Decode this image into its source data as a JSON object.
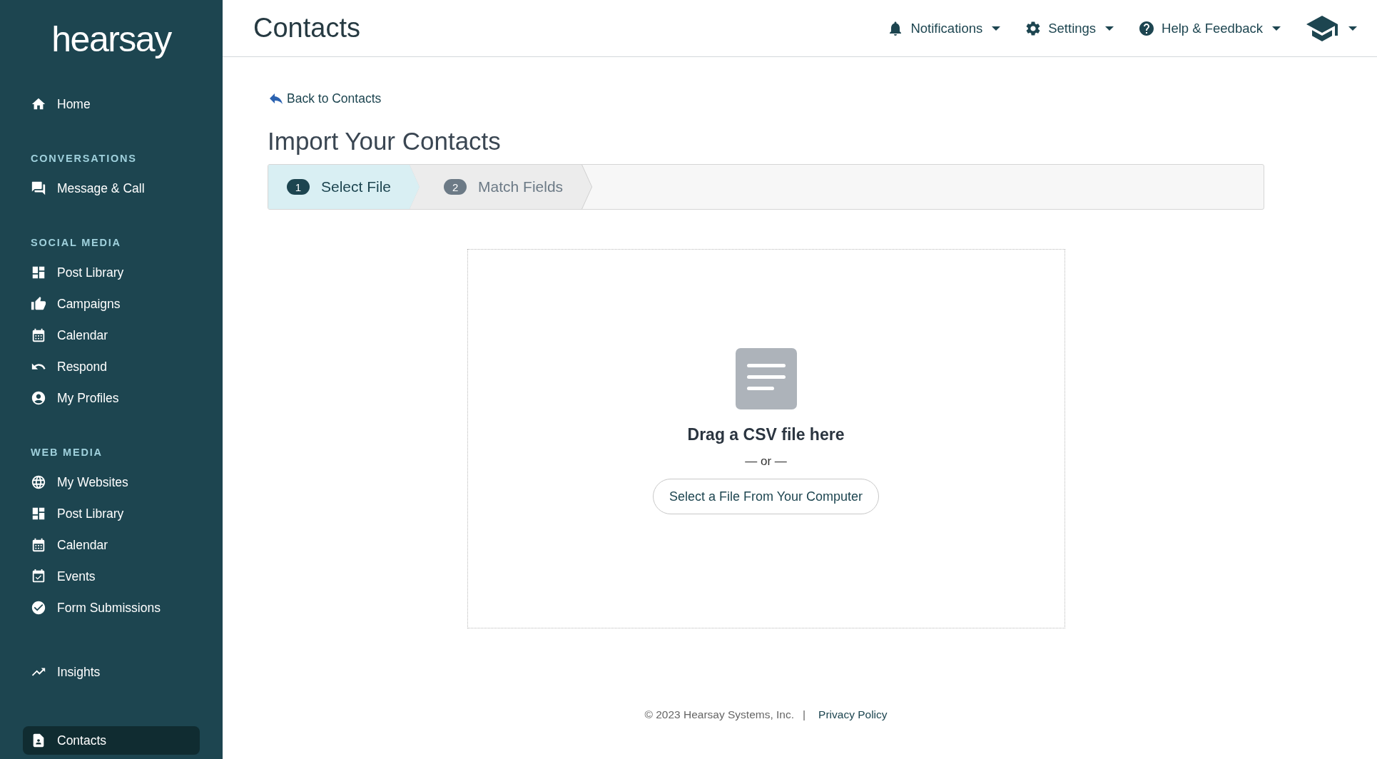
{
  "sidebar": {
    "logo": "hearsay",
    "sections": [
      {
        "items": [
          {
            "label": "Home",
            "selected": false
          }
        ]
      },
      {
        "heading": "CONVERSATIONS",
        "items": [
          {
            "label": "Message & Call",
            "selected": false
          }
        ]
      },
      {
        "heading": "SOCIAL MEDIA",
        "items": [
          {
            "label": "Post Library",
            "selected": false
          },
          {
            "label": "Campaigns",
            "selected": false
          },
          {
            "label": "Calendar",
            "selected": false
          },
          {
            "label": "Respond",
            "selected": false
          },
          {
            "label": "My Profiles",
            "selected": false
          }
        ]
      },
      {
        "heading": "WEB MEDIA",
        "items": [
          {
            "label": "My Websites",
            "selected": false
          },
          {
            "label": "Post Library",
            "selected": false
          },
          {
            "label": "Calendar",
            "selected": false
          },
          {
            "label": "Events",
            "selected": false
          },
          {
            "label": "Form Submissions",
            "selected": false
          }
        ]
      },
      {
        "items": [
          {
            "label": "Insights",
            "selected": false
          }
        ]
      },
      {
        "items": [
          {
            "label": "Contacts",
            "selected": true
          }
        ]
      }
    ]
  },
  "header": {
    "title": "Contacts",
    "menus": [
      {
        "label": "Notifications"
      },
      {
        "label": "Settings"
      },
      {
        "label": "Help & Feedback"
      }
    ]
  },
  "back_link": "Back to Contacts",
  "page_title": "Import Your Contacts",
  "steps": [
    {
      "number": "1",
      "label": "Select File",
      "selected": true
    },
    {
      "number": "2",
      "label": "Match Fields",
      "selected": false
    }
  ],
  "dropzone": {
    "title": "Drag a CSV file here",
    "separator": "— or —",
    "button": "Select a File From Your Computer"
  },
  "footer": {
    "copyright": "© 2023 Hearsay Systems, Inc.",
    "divider": "|",
    "link": "Privacy Policy"
  }
}
